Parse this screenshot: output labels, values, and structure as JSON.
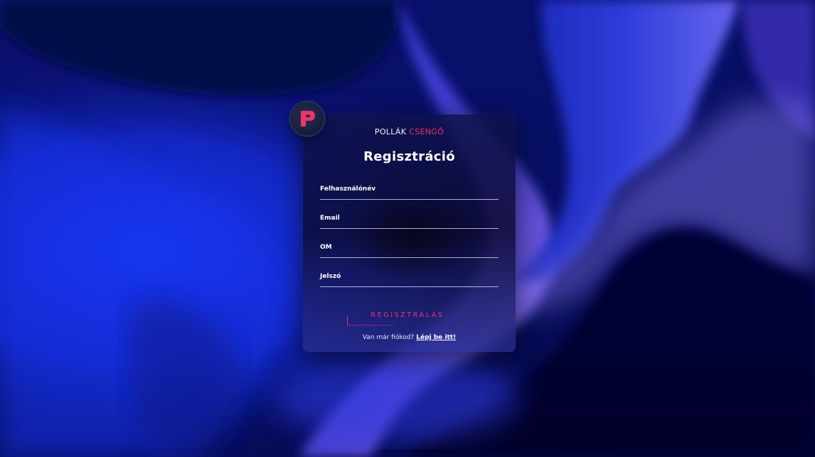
{
  "brand": {
    "name_part1": "POLLÁK",
    "name_part2": "CSENGŐ",
    "accent_color": "#f0336b"
  },
  "logo": {
    "icon": "letter-p-logo",
    "letter": "P"
  },
  "form": {
    "title": "Regisztráció",
    "fields": [
      {
        "label": "Felhasználónév"
      },
      {
        "label": "Email"
      },
      {
        "label": "OM"
      },
      {
        "label": "Jelszó"
      }
    ],
    "submit_label": "REGISZTRÁLÁS"
  },
  "footer": {
    "text": "Van már fiókod?",
    "link": "Lépj be itt!"
  }
}
